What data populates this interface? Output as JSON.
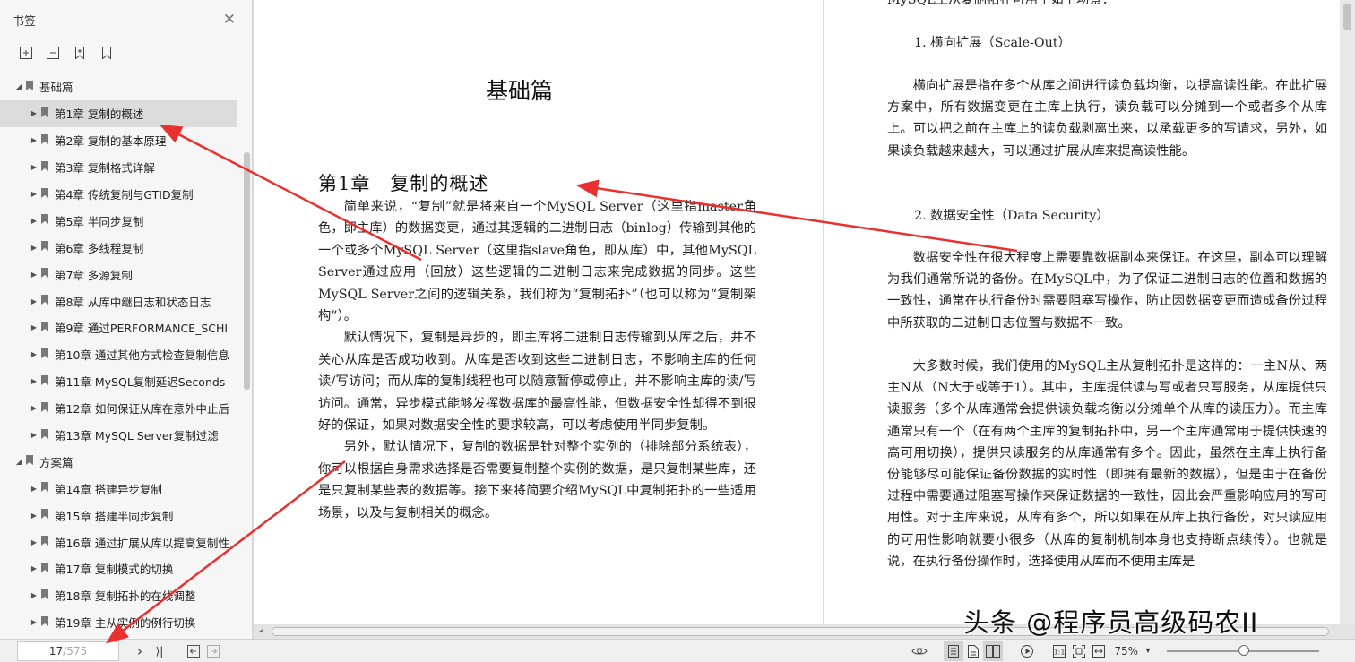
{
  "sidebar": {
    "title": "书签",
    "close_glyph": "✕",
    "tools": [
      "expand-bookmark-icon",
      "collapse-bookmark-icon",
      "add-bookmark-icon",
      "bookmark-icon"
    ],
    "items": [
      {
        "label": "基础篇",
        "level": 0,
        "expanded": true
      },
      {
        "label": "第1章 复制的概述",
        "level": 1,
        "selected": true
      },
      {
        "label": "第2章 复制的基本原理",
        "level": 1
      },
      {
        "label": "第3章 复制格式详解",
        "level": 1
      },
      {
        "label": "第4章 传统复制与GTID复制",
        "level": 1
      },
      {
        "label": "第5章 半同步复制",
        "level": 1
      },
      {
        "label": "第6章 多线程复制",
        "level": 1
      },
      {
        "label": "第7章 多源复制",
        "level": 1
      },
      {
        "label": "第8章 从库中继日志和状态日志",
        "level": 1
      },
      {
        "label": "第9章 通过PERFORMANCE_SCHI",
        "level": 1
      },
      {
        "label": "第10章 通过其他方式检查复制信息",
        "level": 1
      },
      {
        "label": "第11章 MySQL复制延迟Seconds",
        "level": 1
      },
      {
        "label": "第12章 如何保证从库在意外中止后",
        "level": 1
      },
      {
        "label": "第13章 MySQL Server复制过滤",
        "level": 1
      },
      {
        "label": "方案篇",
        "level": 0,
        "expanded": true
      },
      {
        "label": "第14章 搭建异步复制",
        "level": 1
      },
      {
        "label": "第15章 搭建半同步复制",
        "level": 1
      },
      {
        "label": "第16章 通过扩展从库以提高复制性",
        "level": 1
      },
      {
        "label": "第17章 复制模式的切换",
        "level": 1
      },
      {
        "label": "第18章 复制拓扑的在线调整",
        "level": 1
      },
      {
        "label": "第19章 主从实例的例行切换",
        "level": 1
      }
    ]
  },
  "left_page": {
    "part_title": "基础篇",
    "chapter_title": "第1章　复制的概述",
    "paragraphs": [
      "简单来说，“复制”就是将来自一个MySQL Server（这里指master角色，即主库）的数据变更，通过其逻辑的二进制日志（binlog）传输到其他的一个或多个MySQL Server（这里指slave角色，即从库）中，其他MySQL Server通过应用（回放）这些逻辑的二进制日志来完成数据的同步。这些MySQL Server之间的逻辑关系，我们称为“复制拓扑”（也可以称为“复制架构”）。",
      "默认情况下，复制是异步的，即主库将二进制日志传输到从库之后，并不关心从库是否成功收到。从库是否收到这些二进制日志，不影响主库的任何读/写访问；而从库的复制线程也可以随意暂停或停止，并不影响主库的读/写访问。通常，异步模式能够发挥数据库的最高性能，但数据安全性却得不到很好的保证，如果对数据安全性的要求较高，可以考虑使用半同步复制。",
      "另外，默认情况下，复制的数据是针对整个实例的（排除部分系统表），你可以根据自身需求选择是否需要复制整个实例的数据，是只复制某些库，还是只复制某些表的数据等。接下来将简要介绍MySQL中复制拓扑的一些适用场景，以及与复制相关的概念。"
    ]
  },
  "right_page": {
    "top_line": "MySQL主从复制拓扑可用于如下场景：",
    "heading1": "1. 横向扩展（Scale-Out）",
    "para1": "横向扩展是指在多个从库之间进行读负载均衡，以提高读性能。在此扩展方案中，所有数据变更在主库上执行，读负载可以分摊到一个或者多个从库上。可以把之前在主库上的读负载剥离出来，以承载更多的写请求，另外，如果读负载越来越大，可以通过扩展从库来提高读性能。",
    "heading2": "2. 数据安全性（Data Security）",
    "para2": "数据安全性在很大程度上需要靠数据副本来保证。在这里，副本可以理解为我们通常所说的备份。在MySQL中，为了保证二进制日志的位置和数据的一致性，通常在执行备份时需要阻塞写操作，防止因数据变更而造成备份过程中所获取的二进制日志位置与数据不一致。",
    "para3": "大多数时候，我们使用的MySQL主从复制拓扑是这样的：一主N从、两主N从（N大于或等于1）。其中，主库提供读与写或者只写服务，从库提供只读服务（多个从库通常会提供读负载均衡以分摊单个从库的读压力）。而主库通常只有一个（在有两个主库的复制拓扑中，另一个主库通常用于提供快速的高可用切换），提供只读服务的从库通常有多个。因此，虽然在主库上执行备份能够尽可能保证备份数据的实时性（即拥有最新的数据），但是由于在备份过程中需要通过阻塞写操作来保证数据的一致性，因此会严重影响应用的写可用性。对于主库来说，从库有多个，所以如果在从库上执行备份，对只读应用的可用性影响就要小很多（从库的复制机制本身也支持断点续传）。也就是说，在执行备份操作时，选择使用从库而不使用主库是"
  },
  "statusbar": {
    "current_page": "17",
    "total_pages": "/575",
    "zoom": "75%",
    "zoom_fraction": 0.47,
    "nav": {
      "next": "›",
      "last": "⟩|"
    }
  },
  "watermark": "头条 @程序员高级码农II",
  "colors": {
    "annotation": "#e8312f",
    "selection": "#dcdcdc"
  }
}
